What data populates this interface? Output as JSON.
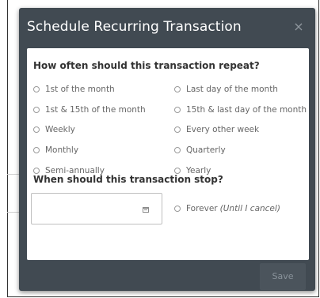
{
  "modal": {
    "title": "Schedule Recurring Transaction",
    "close_icon": "close-icon",
    "close_glyph": "×"
  },
  "frequency": {
    "question": "How often should this transaction repeat?",
    "options": [
      {
        "label": "1st of the month",
        "selected": false
      },
      {
        "label": "Last day of the month",
        "selected": false
      },
      {
        "label": "1st & 15th of the month",
        "selected": false
      },
      {
        "label": "15th & last day of the month",
        "selected": false
      },
      {
        "label": "Weekly",
        "selected": false
      },
      {
        "label": "Every other week",
        "selected": false
      },
      {
        "label": "Monthly",
        "selected": false
      },
      {
        "label": "Quarterly",
        "selected": false
      },
      {
        "label": "Semi-annually",
        "selected": false
      },
      {
        "label": "Yearly",
        "selected": false
      }
    ]
  },
  "stop": {
    "question": "When should this transaction stop?",
    "date_value": "",
    "date_icon": "calendar-icon",
    "forever_label": "Forever",
    "forever_note": "(Until I cancel)"
  },
  "footer": {
    "save_label": "Save"
  },
  "colors": {
    "modal_bg": "#414a52",
    "body_bg": "#ffffff",
    "save_bg": "#4b545c",
    "save_text": "#8a939b"
  }
}
